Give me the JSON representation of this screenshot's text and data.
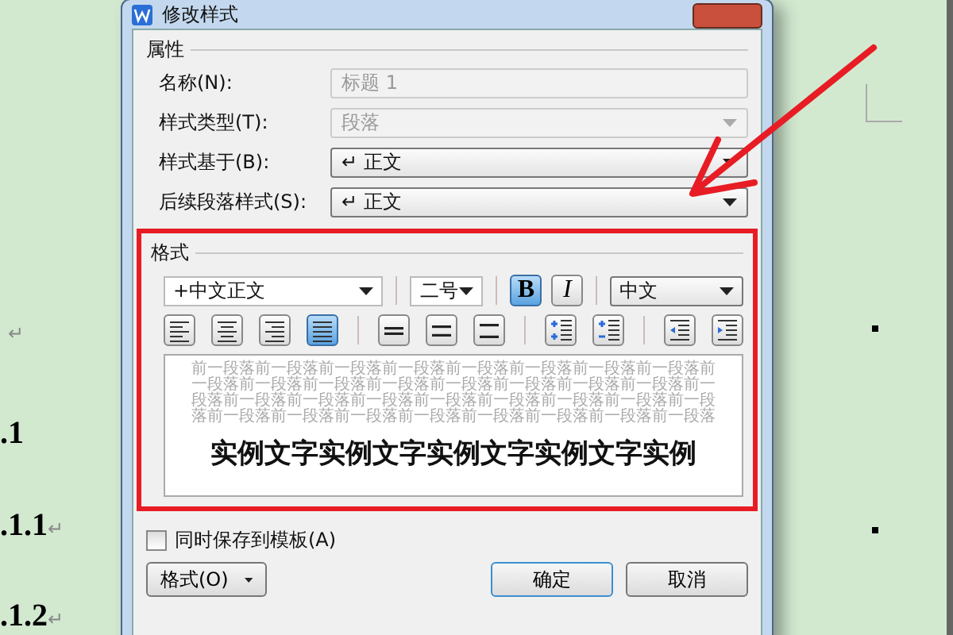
{
  "document": {
    "items": [
      {
        "kind": "mark",
        "text": "↵"
      },
      {
        "kind": "heading",
        "text": ".1"
      },
      {
        "kind": "heading",
        "text": ".1.1",
        "mark": "↵"
      },
      {
        "kind": "heading",
        "text": ".1.2",
        "mark": "↵"
      }
    ]
  },
  "dialog": {
    "title": "修改样式",
    "properties": {
      "label": "属性",
      "fields": [
        {
          "label": "名称(N):",
          "value": "标题 1",
          "kind": "text",
          "disabled": true
        },
        {
          "label": "样式类型(T):",
          "value": "段落",
          "kind": "combo",
          "disabled": true
        },
        {
          "label": "样式基于(B):",
          "value": "↵ 正文",
          "kind": "combo",
          "disabled": false
        },
        {
          "label": "后续段落样式(S):",
          "value": "↵ 正文",
          "kind": "combo",
          "disabled": false
        }
      ]
    },
    "format": {
      "label": "格式",
      "font": "+中文正文",
      "size": "二号",
      "bold": true,
      "italic": false,
      "bold_label": "B",
      "italic_label": "I",
      "script": "中文",
      "alignment": [
        {
          "kind": "left",
          "selected": false
        },
        {
          "kind": "center",
          "selected": false
        },
        {
          "kind": "right",
          "selected": false
        },
        {
          "kind": "justify",
          "selected": true
        }
      ],
      "spacing_tools": [
        {
          "kind": "single"
        },
        {
          "kind": "one-half"
        },
        {
          "kind": "double"
        }
      ],
      "paragraph_tools": [
        {
          "kind": "space-add"
        },
        {
          "kind": "space-remove"
        }
      ],
      "indent_tools": [
        {
          "kind": "outdent"
        },
        {
          "kind": "indent"
        }
      ],
      "preview": {
        "previous_text": "前一段落前一段落前一段落前一段落前一段落前一段落前一段落前一段落前一段落前一段落前一段落前一段落前一段落前一段落前一段落前一段落前一段落前一段落前一段落前一段落前一段落前一段落前一段落前一段落前一段落前一段落前一段落前一段落前一段落前一段落前一段落前一段落前一段落",
        "sample": "实例文字实例文字实例文字实例文字实例"
      }
    },
    "save_to_template": {
      "label": "同时保存到模板(A)",
      "checked": false
    },
    "buttons": [
      {
        "label": "格式(O)",
        "kind": "menu"
      },
      {
        "label": "确定",
        "kind": "default"
      },
      {
        "label": "取消",
        "kind": "normal"
      }
    ]
  }
}
